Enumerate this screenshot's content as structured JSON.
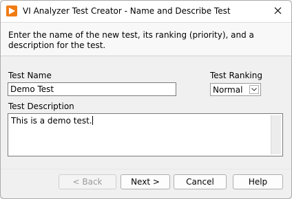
{
  "window": {
    "title": "VI Analyzer Test Creator - Name and Describe Test",
    "app_icon": "labview-play-icon",
    "close_icon": "close-icon"
  },
  "header": {
    "instructions": "Enter the name of the new test, its ranking (priority), and a description for the test."
  },
  "form": {
    "test_name_label": "Test Name",
    "test_name_value": "Demo Test",
    "ranking_label": "Test Ranking",
    "ranking_value": "Normal",
    "description_label": "Test Description",
    "description_value": "This is a demo test."
  },
  "buttons": {
    "back": "< Back",
    "next": "Next >",
    "cancel": "Cancel",
    "help": "Help"
  },
  "colors": {
    "accent": "#f07c13"
  }
}
